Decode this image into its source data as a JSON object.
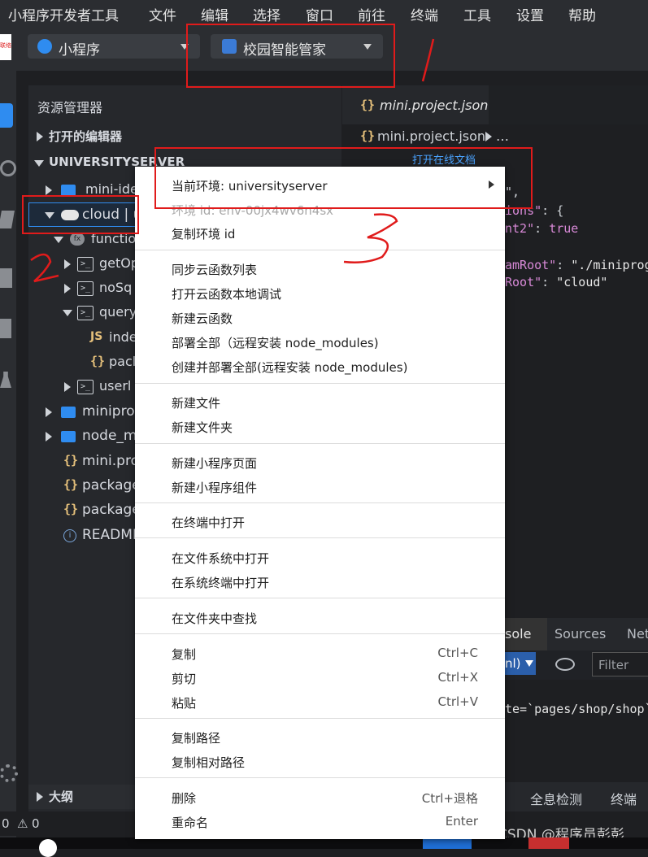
{
  "menubar": {
    "items": [
      "小程序开发者工具",
      "文件",
      "编辑",
      "选择",
      "窗口",
      "前往",
      "终端",
      "工具",
      "设置",
      "帮助"
    ]
  },
  "toolbar": {
    "mode": "小程序",
    "project": "校园智能管家",
    "logo_text": "联络"
  },
  "explorer": {
    "title": "资源管理器",
    "open_editors": "打开的编辑器",
    "root": "UNIVERSITYSERVER",
    "items": {
      "mini_ide": "mini-ide",
      "cloud": "cloud | u",
      "functions": "functio",
      "getop": "getOp",
      "nosq": "noSq",
      "query": "query",
      "index": "inde",
      "pack": "pacl",
      "userl": "userl",
      "miniprog": "miniprog",
      "node_m": "node_m",
      "mini_pro": "mini.pro",
      "package1": "package",
      "package2": "package",
      "readme": "README"
    },
    "js_badge": "JS",
    "outline": "大纲"
  },
  "editor": {
    "tab_label": "mini.project.json",
    "breadcrumb": "mini.project.json",
    "breadcrumb_more": "…",
    "online_doc": "打开在线文档",
    "code": {
      "l1": "\",",
      "l2a": "ions\"",
      "l2b": ": {",
      "l3a": "nt2\"",
      "l3b": ": ",
      "l3c": "true",
      "l4a": "amRoot\"",
      "l4b": ": ",
      "l4c": "\"./miniprog",
      "l5a": "Root\"",
      "l5b": ": ",
      "l5c": "\"cloud\""
    }
  },
  "devtools": {
    "tab_console": "sole",
    "tab_sources": "Sources",
    "tab_net": "Net",
    "ctx_select": "nl)",
    "filter_placeholder": "Filter",
    "log_line": "te=`pages/shop/shop`"
  },
  "bottom_panel": {
    "tab1": "全息检测",
    "tab2": "终端"
  },
  "status": {
    "errors": "0",
    "warnings": "0"
  },
  "watermark": "CSDN @程序员彭彭",
  "context_menu": {
    "env": "当前环境: universityserver",
    "env_id": "环境 id: env-00jx4wv6n4sx",
    "copy_env_id": "复制环境 id",
    "sync_list": "同步云函数列表",
    "open_local_debug": "打开云函数本地调试",
    "new_cloud_fn": "新建云函数",
    "deploy_all": "部署全部（远程安装 node_modules)",
    "create_deploy_all": "创建并部署全部(远程安装 node_modules)",
    "new_file": "新建文件",
    "new_folder": "新建文件夹",
    "new_page": "新建小程序页面",
    "new_component": "新建小程序组件",
    "open_in_terminal": "在终端中打开",
    "open_in_fs": "在文件系统中打开",
    "open_in_sys_terminal": "在系统终端中打开",
    "find_in_folder": "在文件夹中查找",
    "copy": "复制",
    "copy_sc": "Ctrl+C",
    "cut": "剪切",
    "cut_sc": "Ctrl+X",
    "paste": "粘贴",
    "paste_sc": "Ctrl+V",
    "copy_path": "复制路径",
    "copy_rel_path": "复制相对路径",
    "delete": "删除",
    "delete_sc": "Ctrl+退格",
    "rename": "重命名",
    "rename_sc": "Enter"
  },
  "colors": {
    "annotation_red": "#e01b1b",
    "accent_blue": "#2f8cf0",
    "menu_bg": "#ffffff"
  }
}
